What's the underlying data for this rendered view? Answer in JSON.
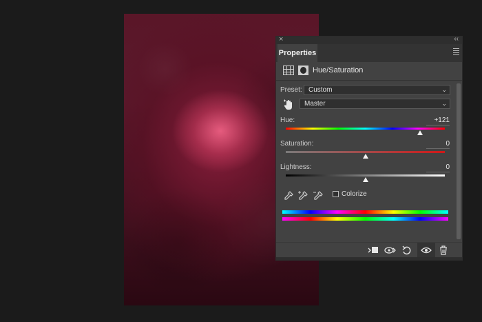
{
  "panel": {
    "title_tab": "Properties",
    "close_glyph": "×",
    "collapse_glyph": "‹‹",
    "adjustment_title": "Hue/Saturation"
  },
  "preset": {
    "label": "Preset:",
    "value": "Custom"
  },
  "channel": {
    "value": "Master"
  },
  "hue": {
    "label": "Hue:",
    "value": "+121",
    "position_fraction": 0.842
  },
  "saturation": {
    "label": "Saturation:",
    "value": "0",
    "position_fraction": 0.5
  },
  "lightness": {
    "label": "Lightness:",
    "value": "0",
    "position_fraction": 0.5
  },
  "colorize": {
    "label": "Colorize",
    "checked": false
  },
  "icons": {
    "adjustment": "hue-saturation-adjustment-icon",
    "mask": "layer-mask-icon",
    "targeted_adjustment": "targeted-adjustment-hand-icon",
    "eyedroppers": [
      "eyedropper-icon",
      "eyedropper-plus-icon",
      "eyedropper-minus-icon"
    ],
    "footer": [
      "clip-to-layer-icon",
      "view-previous-state-icon",
      "reset-icon",
      "visibility-eye-icon",
      "trash-icon"
    ]
  },
  "colors": {
    "panel_bg": "#424242",
    "app_bg": "#1b1b1b",
    "image_tone": "#a8284f"
  }
}
